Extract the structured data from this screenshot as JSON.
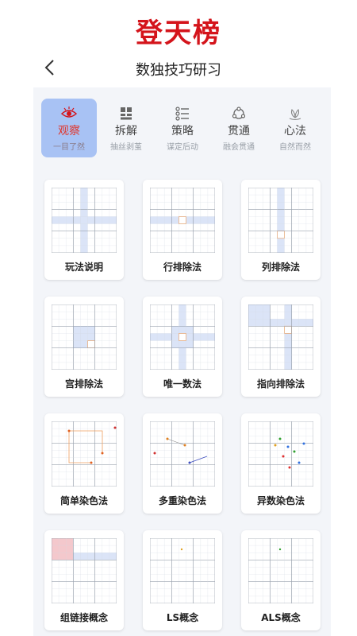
{
  "banner": {
    "title": "登天榜"
  },
  "nav": {
    "title": "数独技巧研习"
  },
  "tabs": [
    {
      "label": "观察",
      "sub": "一目了然",
      "icon": "eye-icon",
      "active": true
    },
    {
      "label": "拆解",
      "sub": "抽丝剥茧",
      "icon": "grid-icon",
      "active": false
    },
    {
      "label": "策略",
      "sub": "谋定后动",
      "icon": "list-icon",
      "active": false
    },
    {
      "label": "贯通",
      "sub": "融会贯通",
      "icon": "network-icon",
      "active": false
    },
    {
      "label": "心法",
      "sub": "自然而然",
      "icon": "lotus-icon",
      "active": false
    }
  ],
  "cards": [
    {
      "label": "玩法说明"
    },
    {
      "label": "行排除法"
    },
    {
      "label": "列排除法"
    },
    {
      "label": "宫排除法"
    },
    {
      "label": "唯一数法"
    },
    {
      "label": "指向排除法"
    },
    {
      "label": "简单染色法"
    },
    {
      "label": "多重染色法"
    },
    {
      "label": "异数染色法"
    },
    {
      "label": "组链接概念"
    },
    {
      "label": "LS概念"
    },
    {
      "label": "ALS概念"
    }
  ],
  "colors": {
    "accent_red": "#d4141b",
    "tab_active_bg": "#a8c2f4",
    "highlight": "#dbe4f7",
    "target": "#f0a060"
  }
}
